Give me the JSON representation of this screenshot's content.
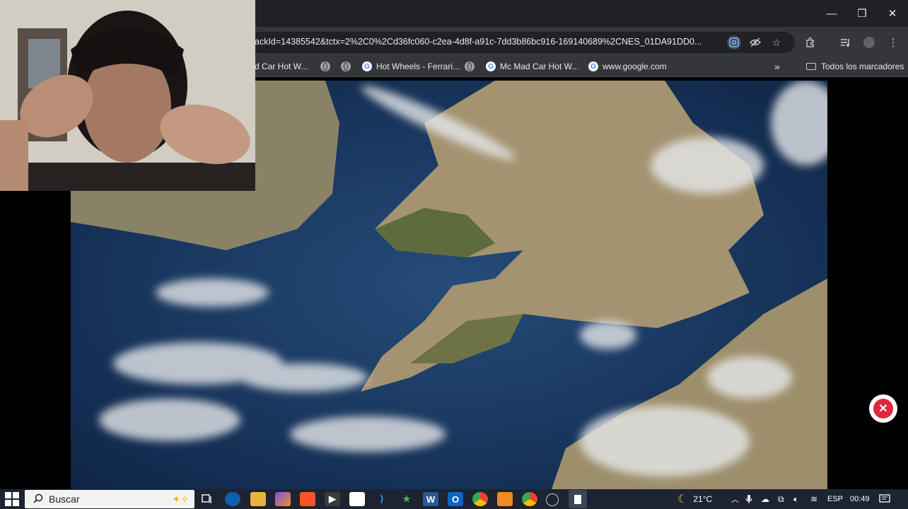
{
  "browser": {
    "url_fragment": "ackId=14385542&tctx=2%2C0%2Cd36fc060-c2ea-4d8f-a91c-7dd3b86bc916-169140689%2CNES_01DA91DD0...",
    "window_controls": {
      "minimize": "—",
      "restore": "❐",
      "close": "✕"
    },
    "bookmarks": [
      {
        "label": "d Car Hot W...",
        "icon": "none"
      },
      {
        "label": "",
        "icon": "globe-icon"
      },
      {
        "label": "",
        "icon": "globe-icon"
      },
      {
        "label": "Hot Wheels - Ferrari...",
        "icon": "google-icon"
      },
      {
        "label": "",
        "icon": "globe-icon"
      },
      {
        "label": "Mc Mad Car Hot W...",
        "icon": "google-icon"
      },
      {
        "label": "www.google.com",
        "icon": "google-icon"
      }
    ],
    "overflow": "»",
    "all_bookmarks": "Todos los marcadores"
  },
  "content": {
    "close_badge": "✕"
  },
  "taskbar": {
    "search_placeholder": "Buscar",
    "temperature": "21°C",
    "language": "ESP",
    "time": "00:49"
  },
  "colors": {
    "chrome_dark": "#202124",
    "toolbar": "#35363a",
    "taskbar": "#1b2430",
    "ocean": "#1c3a63",
    "land": "#9c8e6a",
    "close_red": "#e0283c"
  }
}
